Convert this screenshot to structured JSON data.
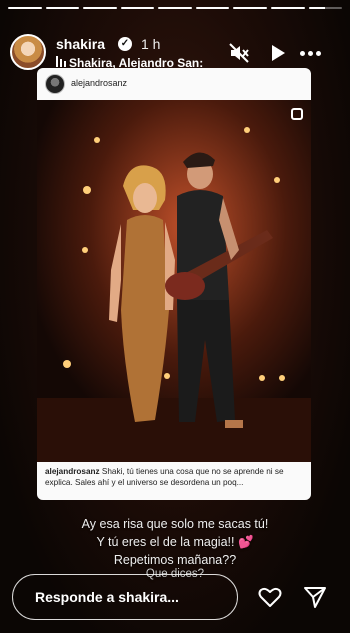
{
  "progress": [
    1,
    1,
    1,
    1,
    1,
    1,
    1,
    1,
    0.5
  ],
  "header": {
    "username": "shakira",
    "time": "1 h",
    "music": "Shakira, Alejandro San:"
  },
  "post": {
    "username": "alejandrosanz",
    "caption_user": "alejandrosanz",
    "caption_text": "Shaki, tú tienes una cosa que no se aprende ni se explica. Sales ahí y el universo se desordena un poq..."
  },
  "sticker": {
    "line1": "Ay esa risa  que solo me sacas tú!",
    "line2": "Y tú eres el de la magia!!",
    "line2_emoji": "💕",
    "line3": "Repetimos mañana??",
    "line4": "Que dices?"
  },
  "reply": {
    "placeholder": "Responde a shakira..."
  },
  "colors": {
    "background": "#0a0605",
    "card": "#fafafa",
    "heart_emoji": "#e040fb"
  }
}
